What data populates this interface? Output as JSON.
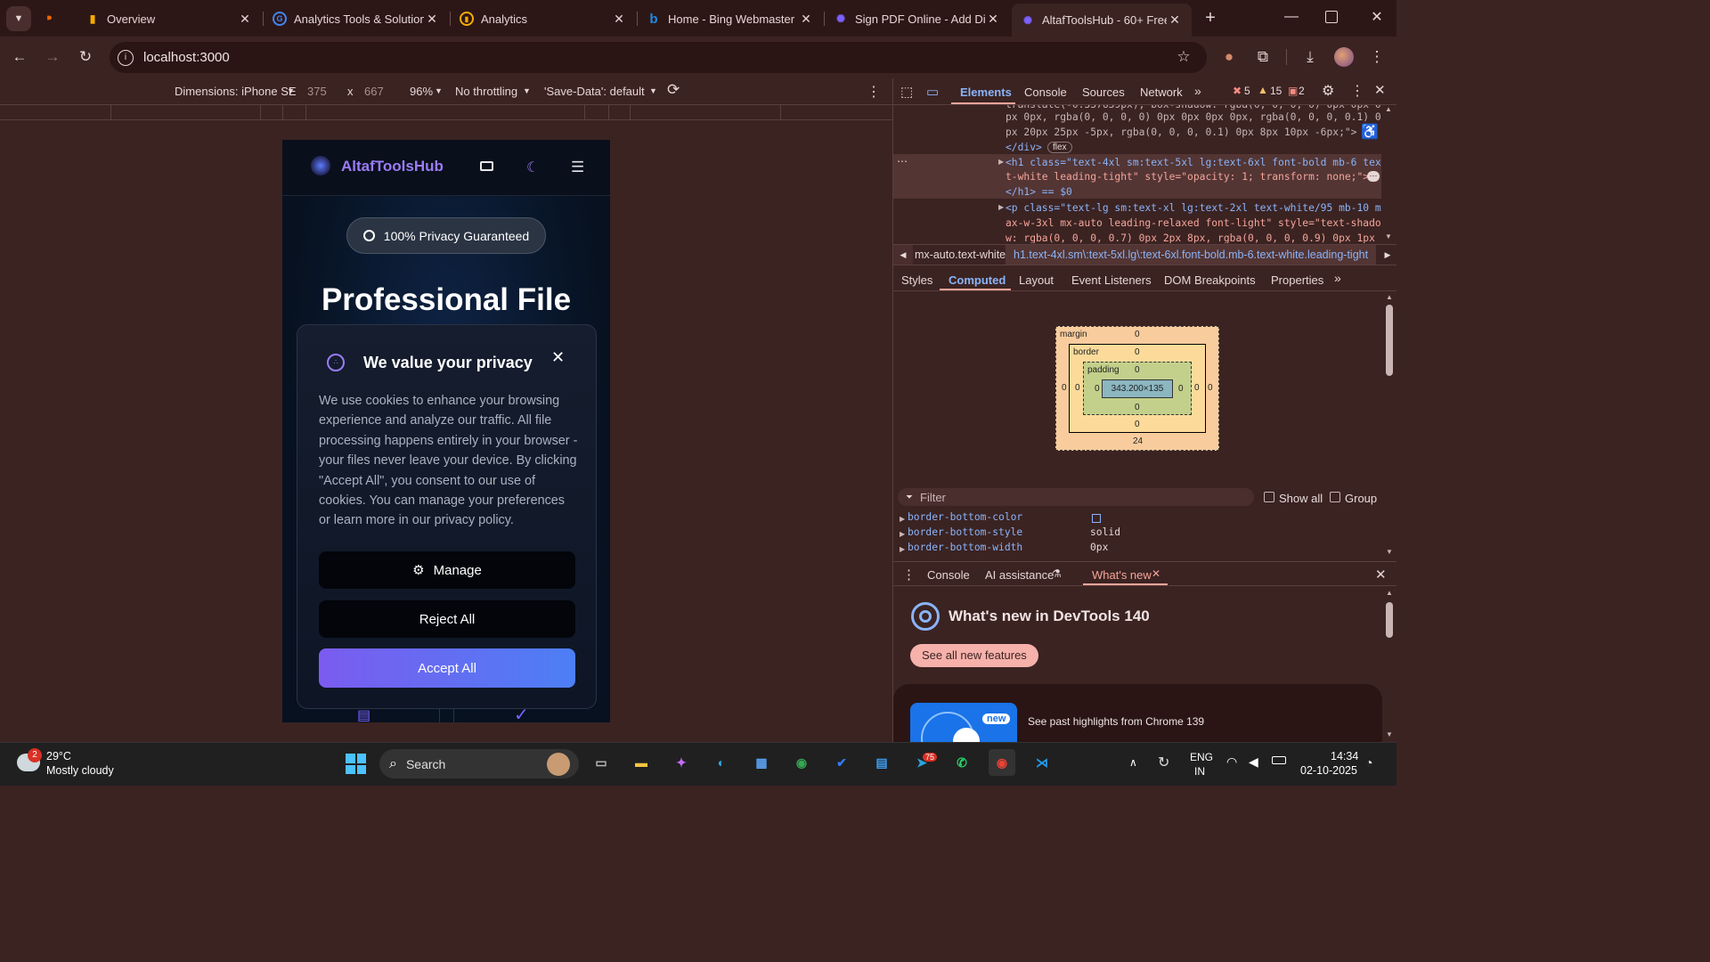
{
  "browser": {
    "tabs": [
      {
        "title": "Overview",
        "icon": "analytics-icon",
        "color": "#f9ab00"
      },
      {
        "title": "Analytics Tools & Solution",
        "icon": "google-icon",
        "color": "#4285f4"
      },
      {
        "title": "Analytics",
        "icon": "analytics-icon",
        "color": "#f9ab00"
      },
      {
        "title": "Home - Bing Webmaster",
        "icon": "bing-icon",
        "color": "#1e88e5"
      },
      {
        "title": "Sign PDF Online - Add Di",
        "icon": "altaf-icon",
        "color": "#7b61ff"
      },
      {
        "title": "AltafToolsHub - 60+ Free",
        "icon": "altaf-icon",
        "color": "#7b61ff"
      }
    ],
    "url": "localhost:3000"
  },
  "device_toolbar": {
    "dimensions": "Dimensions: iPhone SE",
    "width": "375",
    "height": "667",
    "times": "x",
    "zoom": "96%",
    "throttling": "No throttling",
    "save_data": "'Save-Data': default"
  },
  "site": {
    "brand": "AltafToolsHub",
    "badge": "100% Privacy Guaranteed",
    "hero_title": "Professional File",
    "cookie": {
      "title": "We value your privacy",
      "body": "We use cookies to enhance your browsing experience and analyze our traffic. All file processing happens entirely in your browser - your files never leave your device. By clicking \"Accept All\", you consent to our use of cookies. You can manage your preferences or learn more in our privacy policy.",
      "manage": "Manage",
      "reject": "Reject All",
      "accept": "Accept All"
    }
  },
  "devtools": {
    "tabs": [
      "Elements",
      "Console",
      "Sources",
      "Network"
    ],
    "errors": "5",
    "warnings": "15",
    "issues": "2",
    "code_lines": [
      "translate(-0.337639px); box-shadow: rgba(0, 0, 0, 0) 0px 0px 0",
      "px 0px, rgba(0, 0, 0, 0) 0px 0px 0px 0px, rgba(0, 0, 0, 0.1) 0",
      "px 20px 25px -5px, rgba(0, 0, 0, 0.1) 0px 8px 10px -6px;\">",
      "</div>",
      "<h1 class=\"text-4xl sm:text-5xl lg:text-6xl font-bold mb-6 tex",
      "t-white leading-tight\" style=\"opacity: 1; transform: none;\">",
      "</h1> == $0",
      "<p class=\"text-lg sm:text-xl lg:text-2xl text-white/95 mb-10 m",
      "ax-w-3xl mx-auto leading-relaxed font-light\" style=\"text-shado",
      "w: rgba(0, 0, 0, 0.7) 0px 2px 8px, rgba(0, 0, 0, 0.9) 0px 1px"
    ],
    "flex_badge": "flex",
    "breadcrumb1": "mx-auto.text-white",
    "breadcrumb2": "h1.text-4xl.sm\\:text-5xl.lg\\:text-6xl.font-bold.mb-6.text-white.leading-tight",
    "sub_tabs": [
      "Styles",
      "Computed",
      "Layout",
      "Event Listeners",
      "DOM Breakpoints",
      "Properties"
    ],
    "boxmodel": {
      "margin": "margin",
      "border": "border",
      "padding": "padding",
      "content": "343.200×135",
      "zero": "0",
      "margin_bottom": "24"
    },
    "filter_placeholder": "Filter",
    "show_all": "Show all",
    "group": "Group",
    "props": [
      {
        "name": "border-bottom-color",
        "value": ""
      },
      {
        "name": "border-bottom-style",
        "value": "solid"
      },
      {
        "name": "border-bottom-width",
        "value": "0px"
      }
    ],
    "drawer_tabs": [
      "Console",
      "AI assistance",
      "What's new"
    ],
    "whats_new_title": "What's new in DevTools 140",
    "see_all": "See all new features",
    "new_badge": "new",
    "past_highlights": "See past highlights from Chrome 139"
  },
  "taskbar": {
    "weather_temp": "29°C",
    "weather_desc": "Mostly cloudy",
    "weather_badge": "2",
    "search": "Search",
    "lang1": "ENG",
    "lang2": "IN",
    "time": "14:34",
    "date": "02-10-2025",
    "telegram_badge": "75"
  }
}
